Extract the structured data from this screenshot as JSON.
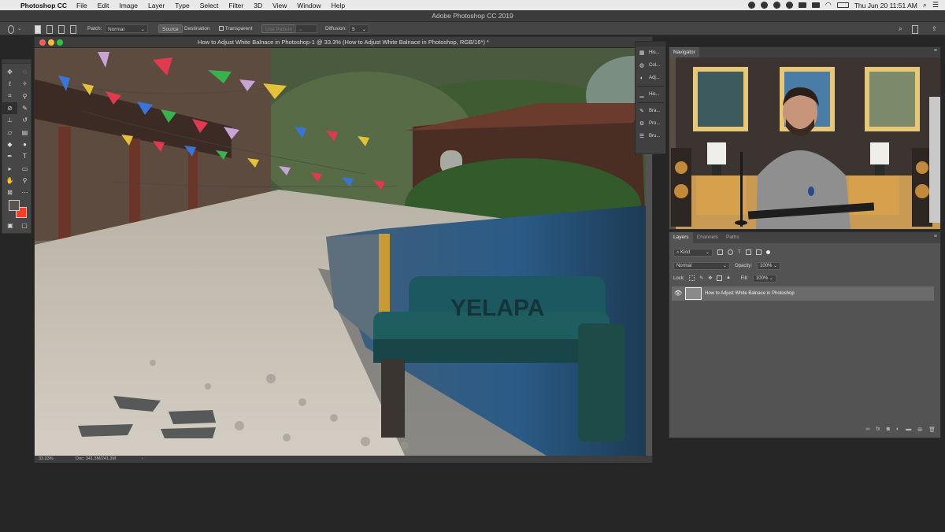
{
  "menubar": {
    "app": "Photoshop CC",
    "items": [
      "File",
      "Edit",
      "Image",
      "Layer",
      "Type",
      "Select",
      "Filter",
      "3D",
      "View",
      "Window",
      "Help"
    ],
    "clock": "Thu Jun 20  11:51 AM"
  },
  "app_title": "Adobe Photoshop CC 2019",
  "options_bar": {
    "patch_label": "Patch:",
    "patch_mode": "Normal",
    "source_label": "Source",
    "destination_label": "Destination",
    "transparent_label": "Transparent",
    "use_pattern_label": "Use Pattern",
    "diffusion_label": "Diffusion:",
    "diffusion_value": "5"
  },
  "document": {
    "title": "How to Adjust White Balnace in Photoshop-1 @ 33.3% (How to Adjust White Balnace in Photoshop, RGB/16*) *",
    "zoom": "33.33%",
    "doc_size": "Doc: 341.3M/241.3M",
    "canvas_text": "YELAPA"
  },
  "collapsed_panels": [
    "His...",
    "Col...",
    "Adj...",
    "His...",
    "Bra...",
    "Pro...",
    "Bru..."
  ],
  "navigator": {
    "tab": "Navigator"
  },
  "layers": {
    "tabs": [
      "Layers",
      "Channels",
      "Paths"
    ],
    "kind_label": "Kind",
    "blend_mode": "Normal",
    "opacity_label": "Opacity:",
    "opacity_value": "100%",
    "lock_label": "Lock:",
    "fill_label": "Fill:",
    "fill_value": "100%",
    "layer_name": "How to Adjust White Balnace in Photoshop"
  },
  "colors": {
    "foreground": "#5a5350",
    "background": "#ff3b24",
    "menubar": "#e9e9e9",
    "panel": "#535353",
    "selected_layer": "#6b6b6b"
  },
  "icons": [
    "apple-icon",
    "wifi-icon",
    "battery-icon",
    "search-icon",
    "move-tool-icon",
    "marquee-tool-icon",
    "lasso-tool-icon",
    "brush-tool-icon",
    "eye-icon"
  ]
}
